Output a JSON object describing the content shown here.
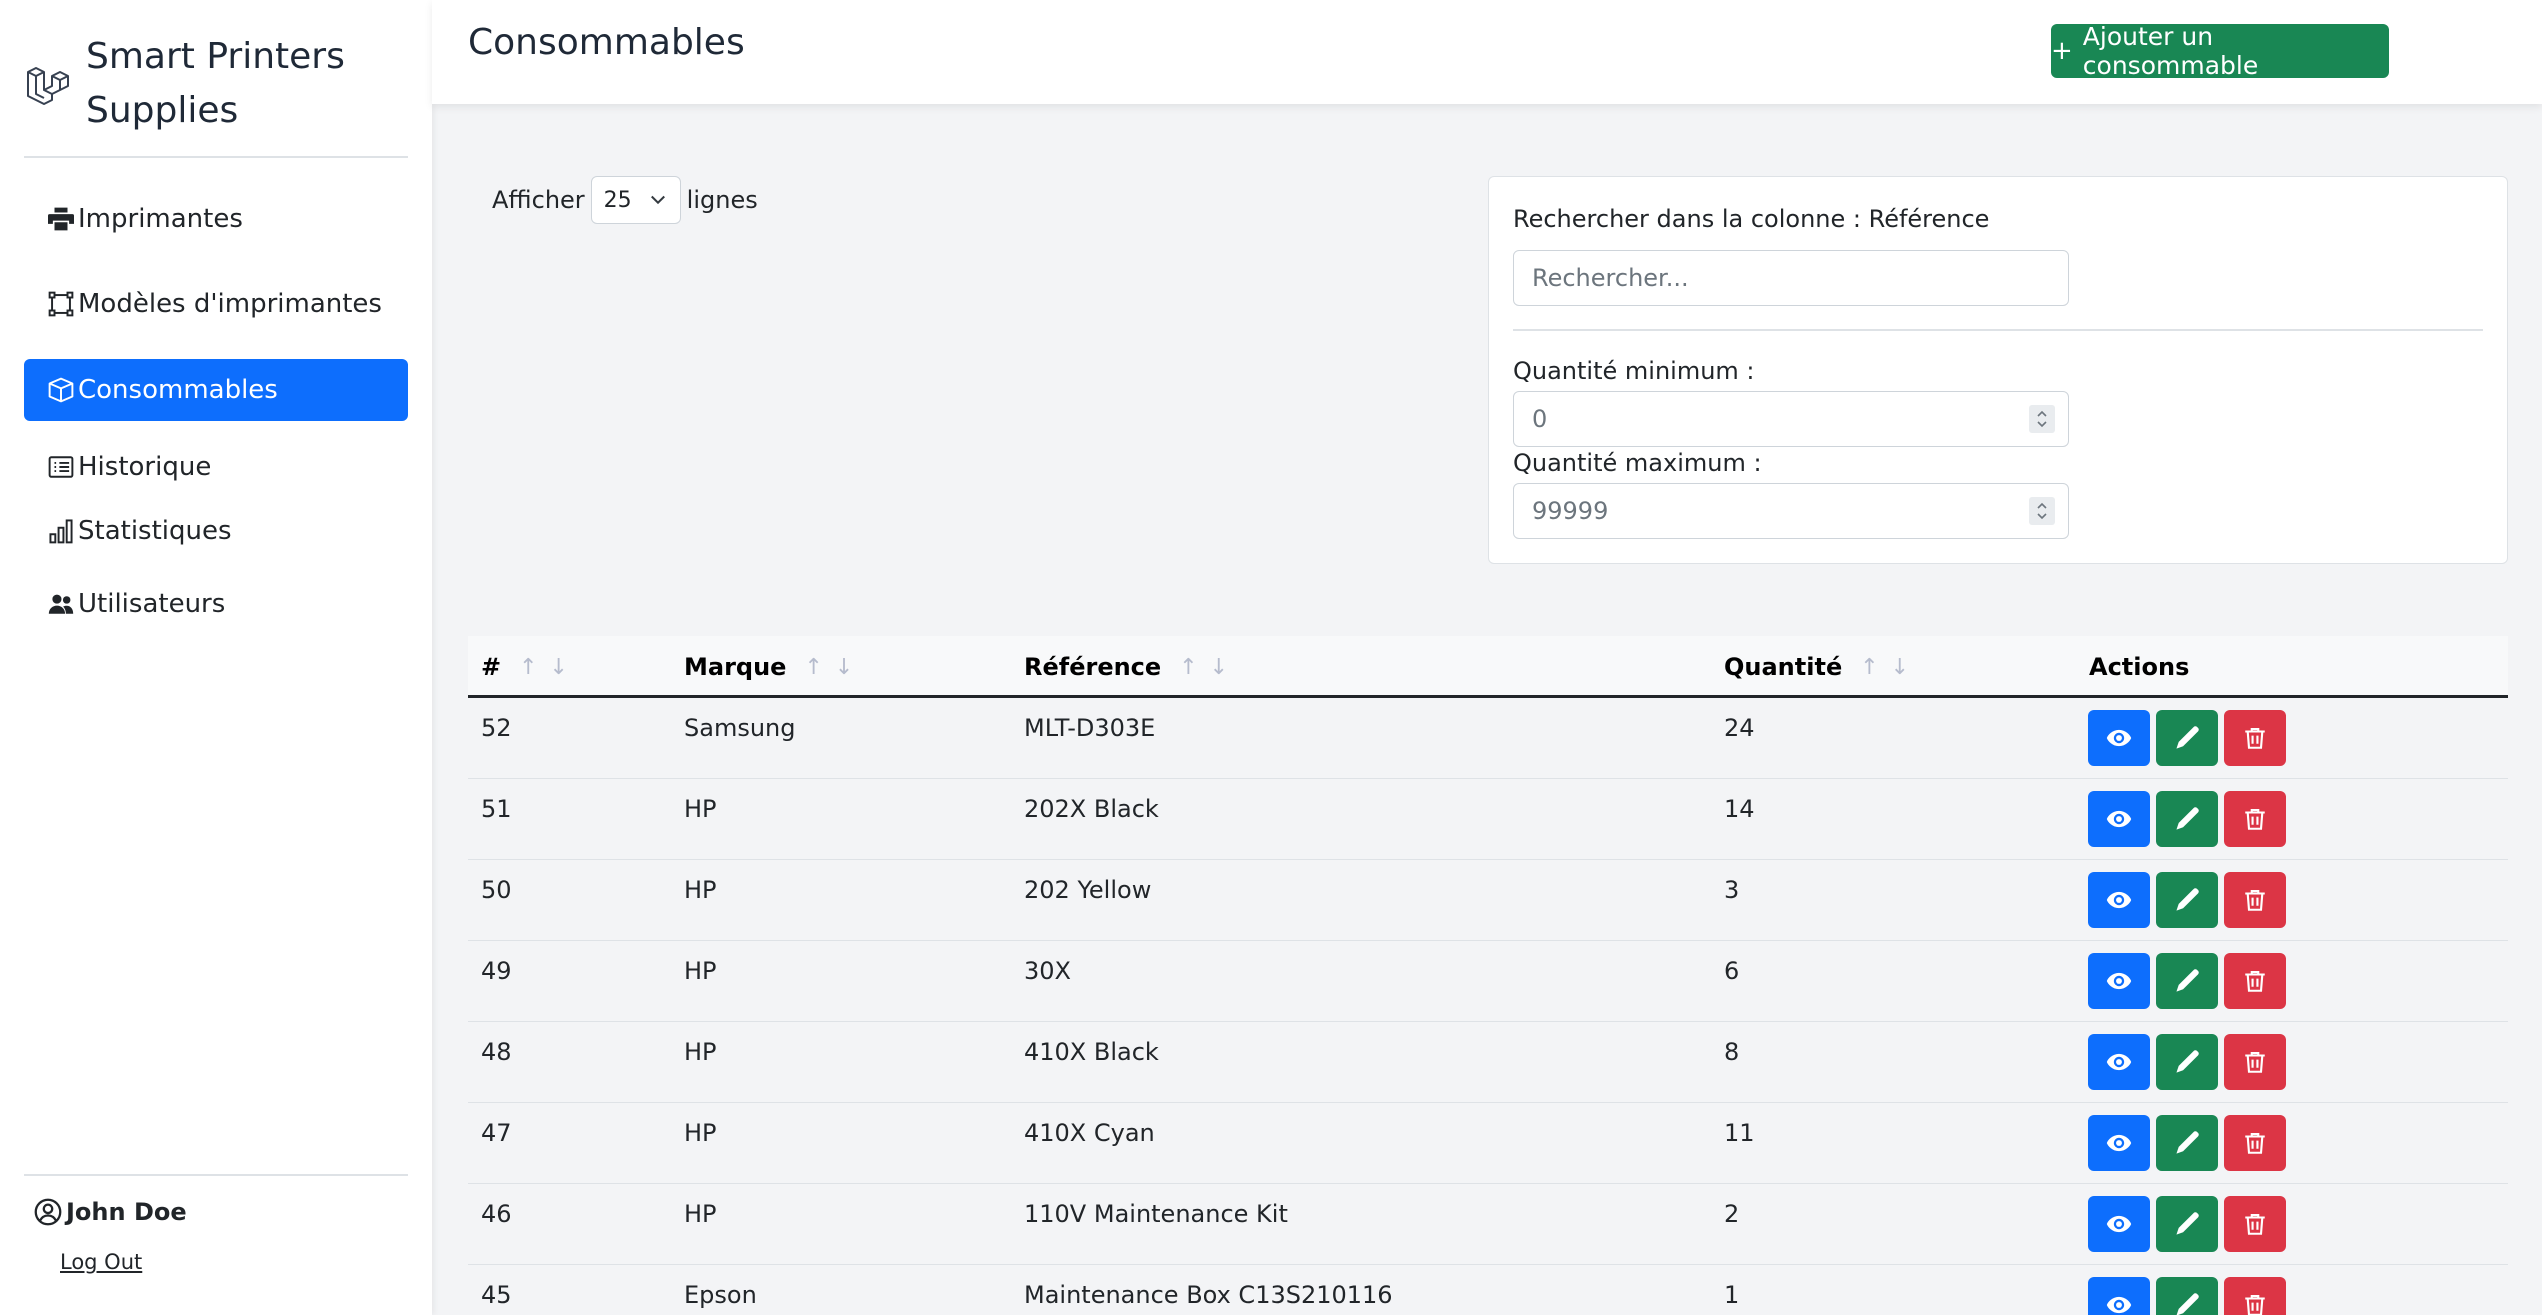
{
  "app": {
    "title": "Smart Printers Supplies"
  },
  "sidebar": {
    "items": [
      {
        "label": "Imprimantes",
        "icon": "printer-icon",
        "active": false
      },
      {
        "label": "Modèles d'imprimantes",
        "icon": "bounding-box-icon",
        "active": false
      },
      {
        "label": "Consommables",
        "icon": "box-icon",
        "active": true
      },
      {
        "label": "Historique",
        "icon": "list-icon",
        "active": false
      },
      {
        "label": "Statistiques",
        "icon": "bar-chart-icon",
        "active": false
      },
      {
        "label": "Utilisateurs",
        "icon": "people-icon",
        "active": false
      }
    ],
    "user": {
      "name": "John Doe",
      "logout_label": "Log Out"
    }
  },
  "header": {
    "title": "Consommables",
    "add_button_label": "Ajouter un consommable"
  },
  "show_lines": {
    "prefix": "Afficher",
    "value": "25",
    "suffix": "lignes"
  },
  "filters": {
    "search_label": "Rechercher dans la colonne : Référence",
    "search_placeholder": "Rechercher...",
    "min_label": "Quantité minimum :",
    "min_placeholder": "0",
    "max_label": "Quantité maximum :",
    "max_placeholder": "99999"
  },
  "table": {
    "columns": [
      "#",
      "Marque",
      "Référence",
      "Quantité",
      "Actions"
    ],
    "rows": [
      {
        "id": "52",
        "brand": "Samsung",
        "reference": "MLT-D303E",
        "quantity": "24"
      },
      {
        "id": "51",
        "brand": "HP",
        "reference": "202X Black",
        "quantity": "14"
      },
      {
        "id": "50",
        "brand": "HP",
        "reference": "202 Yellow",
        "quantity": "3"
      },
      {
        "id": "49",
        "brand": "HP",
        "reference": "30X",
        "quantity": "6"
      },
      {
        "id": "48",
        "brand": "HP",
        "reference": "410X Black",
        "quantity": "8"
      },
      {
        "id": "47",
        "brand": "HP",
        "reference": "410X Cyan",
        "quantity": "11"
      },
      {
        "id": "46",
        "brand": "HP",
        "reference": "110V Maintenance Kit",
        "quantity": "2"
      },
      {
        "id": "45",
        "brand": "Epson",
        "reference": "Maintenance Box C13S210116",
        "quantity": "1"
      }
    ]
  },
  "colors": {
    "primary": "#0d6efd",
    "success": "#198754",
    "danger": "#dc3545",
    "background": "#f3f4f6"
  }
}
